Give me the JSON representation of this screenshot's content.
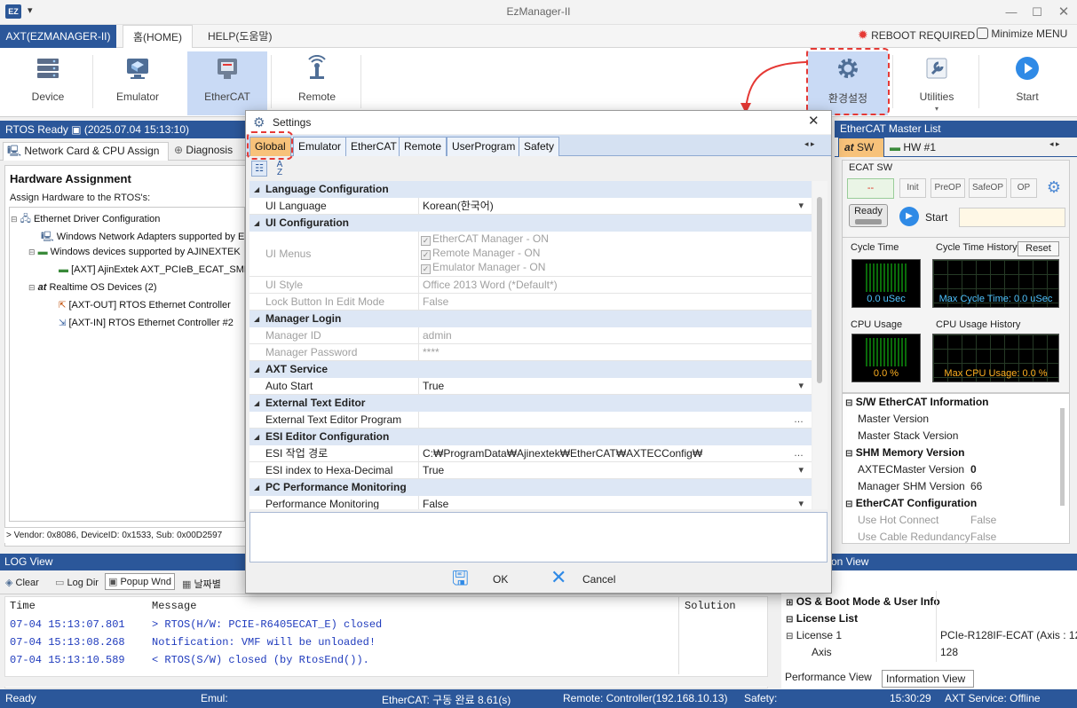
{
  "window": {
    "title": "EzManager-II",
    "app_icon": "EZ"
  },
  "menu": {
    "app_tab": "AXT(EZMANAGER-II)",
    "home_tab": "홈(HOME)",
    "help_tab": "HELP(도움말)",
    "reboot_required": "REBOOT REQUIRED",
    "minimize_menu": "Minimize MENU"
  },
  "ribbon": {
    "device": "Device",
    "emulator": "Emulator",
    "ethercat": "EtherCAT",
    "remote": "Remote",
    "settings": "환경설정",
    "utilities": "Utilities",
    "start": "Start"
  },
  "left": {
    "status": "RTOS Ready ▣ (2025.07.04 15:13:10)",
    "tab_network": "Network Card & CPU Assign",
    "tab_diagnosis": "Diagnosis",
    "title": "Hardware Assignment",
    "subtitle": "Assign Hardware to the RTOS's:",
    "tree": [
      "Ethernet Driver Configuration",
      "Windows Network Adapters supported by E",
      "Windows devices supported by AJINEXTEK",
      "[AXT] AjinExtek AXT_PCIeB_ECAT_SMP",
      "Realtime OS Devices (2)",
      "[AXT-OUT] RTOS Ethernet Controller",
      "[AXT-IN] RTOS Ethernet Controller #2"
    ],
    "vendor": "> Vendor: 0x8086, DeviceID: 0x1533, Sub: 0x00D2597"
  },
  "log": {
    "title": "LOG View",
    "clear": "Clear",
    "log_dir": "Log Dir",
    "popup": "Popup Wnd",
    "date": "날짜별",
    "col_time": "Time",
    "col_message": "Message",
    "col_solution": "Solution",
    "rows": [
      {
        "time": "07-04 15:13:07.801",
        "message": "> RTOS(H/W: PCIE-R6405ECAT_E) closed"
      },
      {
        "time": "07-04 15:13:08.268",
        "message": "Notification: VMF will be unloaded!"
      },
      {
        "time": "07-04 15:13:10.589",
        "message": "< RTOS(S/W) closed (by RtosEnd())."
      }
    ]
  },
  "right": {
    "title": "EtherCAT Master List",
    "tab_sw": "SW",
    "tab_hw": "HW #1",
    "at_logo": "at",
    "ecat_sw": "ECAT SW",
    "state_value": "--",
    "states": [
      "Init",
      "PreOP",
      "SafeOP",
      "OP"
    ],
    "ready": "Ready",
    "start": "Start",
    "cycle_time": "Cycle Time",
    "cycle_history": "Cycle Time History",
    "reset": "Reset",
    "cycle_value": "0.0 uSec",
    "max_cycle": "Max Cycle Time: 0.0 uSec",
    "cpu_usage": "CPU Usage",
    "cpu_history": "CPU Usage History",
    "cpu_value": "0.0 %",
    "max_cpu": "Max CPU Usage: 0.0 %",
    "info": [
      {
        "header": "S/W EtherCAT Information"
      },
      {
        "key": "Master Version",
        "value": ""
      },
      {
        "key": "Master Stack Version",
        "value": ""
      },
      {
        "header": "SHM Memory Version"
      },
      {
        "key": "AXTECMaster Version",
        "value": "0"
      },
      {
        "key": "Manager SHM Version",
        "value": "66"
      },
      {
        "header": "EtherCAT Configuration"
      },
      {
        "key": "Use Hot Connect",
        "value": "False"
      },
      {
        "key": "Use Cable Redundancy",
        "value": "False"
      }
    ]
  },
  "info_view": {
    "title": "on View",
    "os_boot": "OS & Boot Mode & User Info",
    "license_list": "License List",
    "license1_key": "License 1",
    "license1_val": "PCIe-R128IF-ECAT (Axis : 12",
    "axis_key": "Axis",
    "axis_val": "128",
    "tab_perf": "Performance View",
    "tab_info": "Information View"
  },
  "status": {
    "ready": "Ready",
    "emul": "Emul:",
    "ethercat": "EtherCAT: 구동 완료 8.61(s)",
    "remote": "Remote: Controller(192.168.10.13)",
    "safety": "Safety:",
    "time": "15:30:29",
    "axt_service": "AXT Service: Offline"
  },
  "dialog": {
    "title": "Settings",
    "tabs": [
      "Global",
      "Emulator",
      "EtherCAT",
      "Remote",
      "UserProgram",
      "Safety"
    ],
    "ok": "OK",
    "cancel": "Cancel",
    "grid": [
      {
        "cat": "Language Configuration"
      },
      {
        "k": "UI Language",
        "v": "Korean(한국어)",
        "dd": true
      },
      {
        "cat": "UI Configuration"
      },
      {
        "k": "UI Menus",
        "dis": true,
        "checks": [
          "EtherCAT Manager - ON",
          "Remote Manager - ON",
          "Emulator Manager - ON"
        ]
      },
      {
        "k": "UI Style",
        "v": "Office 2013 Word (*Default*)",
        "dis": true
      },
      {
        "k": "Lock Button In Edit Mode",
        "v": "False",
        "dis": true
      },
      {
        "cat": "Manager Login"
      },
      {
        "k": "Manager ID",
        "v": "admin",
        "dis": true
      },
      {
        "k": "Manager Password",
        "v": "****",
        "dis": true
      },
      {
        "cat": "AXT Service"
      },
      {
        "k": "Auto Start",
        "v": "True",
        "dd": true
      },
      {
        "cat": "External Text Editor"
      },
      {
        "k": "External Text Editor Program",
        "v": "",
        "dots": true
      },
      {
        "cat": "ESI Editor Configuration"
      },
      {
        "k": "ESI 작업 경로",
        "v": "C:₩ProgramData₩Ajinextek₩EtherCAT₩AXTECConfig₩",
        "dots": true
      },
      {
        "k": "ESI index to Hexa-Decimal",
        "v": "True",
        "dd": true
      },
      {
        "cat": "PC Performance Monitoring"
      },
      {
        "k": "Performance Monitoring",
        "v": "False",
        "dd": true
      }
    ]
  },
  "colors": {
    "accent": "#2b579a",
    "selected_tab": "#f7c27a",
    "annotation": "#e53935",
    "log_text": "#1f3bbd"
  }
}
